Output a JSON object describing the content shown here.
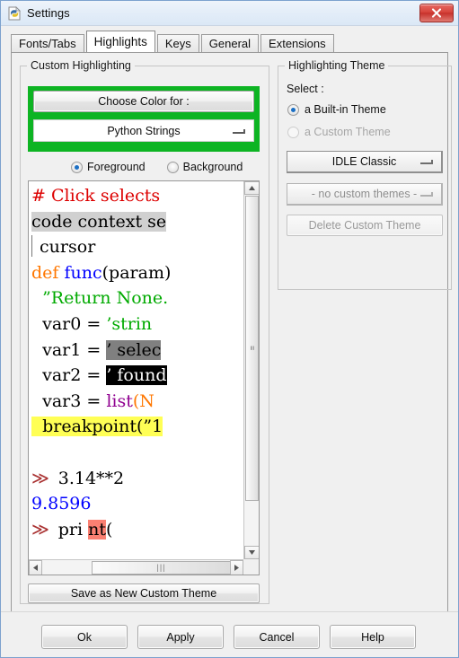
{
  "window": {
    "title": "Settings",
    "icon": "python-file-icon",
    "close_label": "×"
  },
  "tabs": [
    {
      "label": "Fonts/Tabs",
      "active": false
    },
    {
      "label": "Highlights",
      "active": true
    },
    {
      "label": "Keys",
      "active": false
    },
    {
      "label": "General",
      "active": false
    },
    {
      "label": "Extensions",
      "active": false
    }
  ],
  "custom_highlighting": {
    "group_label": "Custom Highlighting",
    "choose_color_label": "Choose Color for :",
    "element_value": "Python Strings",
    "foreground_label": "Foreground",
    "background_label": "Background",
    "foreground_selected": true,
    "background_selected": false,
    "save_theme_label": "Save as New Custom Theme",
    "focus_frame_color": "#0db423"
  },
  "highlighting_theme": {
    "group_label": "Highlighting Theme",
    "select_label": "Select :",
    "builtin_label": "a Built-in Theme",
    "custom_label": "a Custom Theme",
    "builtin_selected": true,
    "custom_selected": false,
    "builtin_value": "IDLE Classic",
    "custom_value": "- no custom themes -",
    "delete_label": "Delete Custom Theme"
  },
  "preview": {
    "lines": [
      {
        "id": "l1",
        "segments": [
          {
            "text": "# Click selects",
            "style": "comment"
          }
        ]
      },
      {
        "id": "l2",
        "segments": [
          {
            "text": "code context se",
            "style": "context-highlight"
          }
        ]
      },
      {
        "id": "l3",
        "segments": [
          {
            "text": "caret",
            "style": "caret"
          },
          {
            "text": " cursor",
            "style": "plain"
          }
        ]
      },
      {
        "id": "l4",
        "segments": [
          {
            "text": "def ",
            "style": "keyword"
          },
          {
            "text": "func",
            "style": "definition"
          },
          {
            "text": "(param)",
            "style": "plain"
          }
        ]
      },
      {
        "id": "l5",
        "segments": [
          {
            "text": "  ”Return None.",
            "style": "string"
          }
        ]
      },
      {
        "id": "l6",
        "segments": [
          {
            "text": "  var0 = ",
            "style": "plain"
          },
          {
            "text": "’strin",
            "style": "string"
          }
        ]
      },
      {
        "id": "l7",
        "segments": [
          {
            "text": "  var1 = ",
            "style": "plain"
          },
          {
            "text": "’ selec",
            "style": "selection-highlight"
          }
        ]
      },
      {
        "id": "l8",
        "segments": [
          {
            "text": "  var2 = ",
            "style": "plain"
          },
          {
            "text": "’ found",
            "style": "found-highlight"
          }
        ]
      },
      {
        "id": "l9",
        "segments": [
          {
            "text": "  var3 = ",
            "style": "plain"
          },
          {
            "text": "list",
            "style": "builtin"
          },
          {
            "text": "(N",
            "style": "keyword"
          }
        ]
      },
      {
        "id": "l10",
        "segments": [
          {
            "text": "  breakpoint(”1",
            "style": "breakpoint-highlight"
          }
        ]
      },
      {
        "id": "l11",
        "segments": [
          {
            "text": "",
            "style": "plain"
          }
        ]
      },
      {
        "id": "l12",
        "segments": [
          {
            "text": "≫ ",
            "style": "console"
          },
          {
            "text": " 3.14**2",
            "style": "plain"
          }
        ]
      },
      {
        "id": "l13",
        "segments": [
          {
            "text": "9.8596",
            "style": "stdout"
          }
        ]
      },
      {
        "id": "l14",
        "segments": [
          {
            "text": "≫ ",
            "style": "console"
          },
          {
            "text": " pri ",
            "style": "plain"
          },
          {
            "text": "nt",
            "style": "error-highlight"
          },
          {
            "text": "(",
            "style": "plain"
          }
        ]
      }
    ],
    "vertical_scrollbar": {
      "up_arrow": "▲",
      "down_arrow": "▼",
      "grip": "≡"
    },
    "horizontal_scrollbar": {
      "left_arrow": "◀",
      "right_arrow": "▶",
      "grip": "‖‖"
    }
  },
  "footer": {
    "ok_label": "Ok",
    "apply_label": "Apply",
    "cancel_label": "Cancel",
    "help_label": "Help"
  }
}
